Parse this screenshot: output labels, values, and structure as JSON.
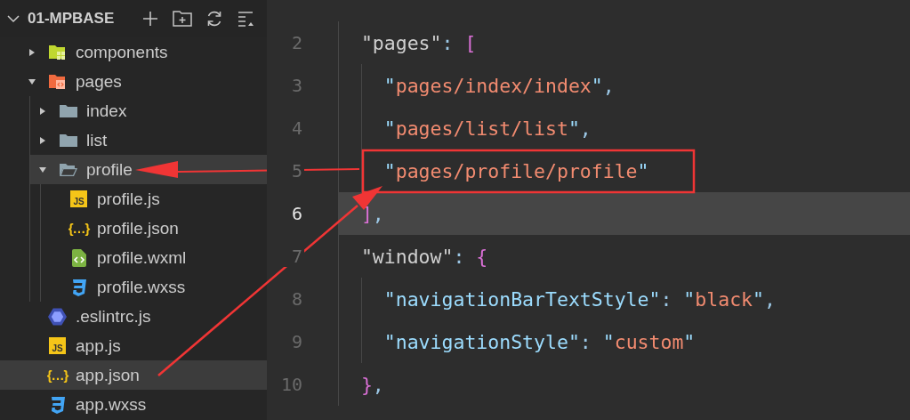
{
  "explorer": {
    "title": "01-MPBASE",
    "expanded": true
  },
  "tree": [
    {
      "name": "components",
      "kind": "components",
      "expanded": false,
      "selected": false
    },
    {
      "name": "pages",
      "kind": "pages",
      "expanded": true,
      "selected": false,
      "children": [
        {
          "name": "index",
          "kind": "folder",
          "expanded": false,
          "selected": false
        },
        {
          "name": "list",
          "kind": "folder",
          "expanded": false,
          "selected": false
        },
        {
          "name": "profile",
          "kind": "folder",
          "expanded": true,
          "selected": true,
          "children": [
            {
              "name": "profile.js",
              "kind": "js",
              "badge": "JS",
              "selected": false
            },
            {
              "name": "profile.json",
              "kind": "json",
              "badge": "{…}",
              "selected": false
            },
            {
              "name": "profile.wxml",
              "kind": "wxml",
              "selected": false
            },
            {
              "name": "profile.wxss",
              "kind": "wxss",
              "selected": false
            }
          ]
        }
      ]
    },
    {
      "name": ".eslintrc.js",
      "kind": "eslint",
      "selected": false
    },
    {
      "name": "app.js",
      "kind": "js",
      "badge": "JS",
      "selected": false
    },
    {
      "name": "app.json",
      "kind": "json",
      "badge": "{…}",
      "selected": true
    },
    {
      "name": "app.wxss",
      "kind": "wxss",
      "selected": false
    }
  ],
  "editor": {
    "lines": [
      {
        "number": "2",
        "current": false,
        "tokens": [
          {
            "kind": "key-top",
            "text": "\"pages\""
          },
          {
            "kind": "punct",
            "text": ": "
          },
          {
            "kind": "bracket",
            "text": "["
          }
        ],
        "children": [
          {
            "number": "3",
            "current": false,
            "tokens": [
              {
                "kind": "quote",
                "text": "\""
              },
              {
                "kind": "string",
                "text": "pages/index/index"
              },
              {
                "kind": "quote",
                "text": "\""
              },
              {
                "kind": "punct",
                "text": ","
              }
            ]
          },
          {
            "number": "4",
            "current": false,
            "tokens": [
              {
                "kind": "quote",
                "text": "\""
              },
              {
                "kind": "string",
                "text": "pages/list/list"
              },
              {
                "kind": "quote",
                "text": "\""
              },
              {
                "kind": "punct",
                "text": ","
              }
            ]
          },
          {
            "number": "5",
            "current": false,
            "tokens": [
              {
                "kind": "quote",
                "text": "\""
              },
              {
                "kind": "string",
                "text": "pages/profile/profile"
              },
              {
                "kind": "quote",
                "text": "\""
              }
            ]
          }
        ]
      },
      {
        "number": "6",
        "current": true,
        "tokens": [
          {
            "kind": "bracket",
            "text": "]"
          },
          {
            "kind": "punct",
            "text": ","
          }
        ]
      },
      {
        "number": "7",
        "current": false,
        "tokens": [
          {
            "kind": "key-top",
            "text": "\"window\""
          },
          {
            "kind": "punct",
            "text": ": "
          },
          {
            "kind": "bracket",
            "text": "{"
          }
        ],
        "children": [
          {
            "number": "8",
            "current": false,
            "tokens": [
              {
                "kind": "key",
                "text": "\"navigationBarTextStyle\""
              },
              {
                "kind": "punct",
                "text": ": "
              },
              {
                "kind": "quote",
                "text": "\""
              },
              {
                "kind": "string",
                "text": "black"
              },
              {
                "kind": "quote",
                "text": "\""
              },
              {
                "kind": "punct",
                "text": ","
              }
            ]
          },
          {
            "number": "9",
            "current": false,
            "tokens": [
              {
                "kind": "key",
                "text": "\"navigationStyle\""
              },
              {
                "kind": "punct",
                "text": ": "
              },
              {
                "kind": "quote",
                "text": "\""
              },
              {
                "kind": "string",
                "text": "custom"
              },
              {
                "kind": "quote",
                "text": "\""
              }
            ]
          }
        ]
      },
      {
        "number": "10",
        "current": false,
        "tokens": [
          {
            "kind": "bracket",
            "text": "}"
          },
          {
            "kind": "punct",
            "text": ","
          }
        ]
      }
    ]
  }
}
